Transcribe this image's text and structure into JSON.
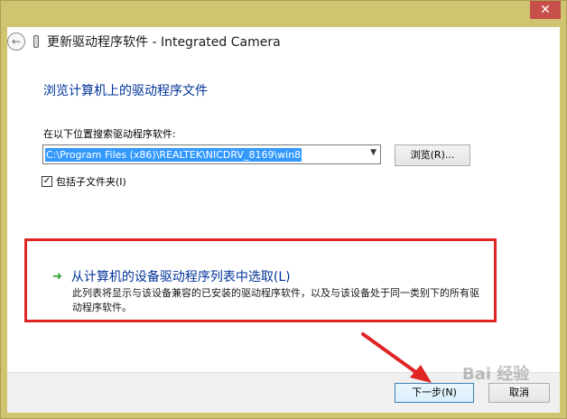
{
  "window": {
    "title": "更新驱动程序软件 - Integrated Camera",
    "close_glyph": "✕"
  },
  "page": {
    "heading": "浏览计算机上的驱动程序文件",
    "search_label": "在以下位置搜索驱动程序软件:",
    "path_value": "C:\\Program Files (x86)\\REALTEK\\NICDRV_8169\\win8",
    "browse_label": "浏览(R)...",
    "include_subfolders_label": "包括子文件夹(I)",
    "include_subfolders_checked": true
  },
  "pick": {
    "title": "从计算机的设备驱动程序列表中选取(L)",
    "description": "此列表将显示与该设备兼容的已安装的驱动程序软件，以及与该设备处于同一类别下的所有驱动程序软件。"
  },
  "footer": {
    "next_label": "下一步(N)",
    "cancel_label": "取消"
  },
  "watermark": {
    "text": "Bai 经验"
  },
  "colors": {
    "frame": "#cfc470",
    "link_blue": "#003399",
    "highlight_red": "#e02525",
    "selection_blue": "#3399ff"
  }
}
